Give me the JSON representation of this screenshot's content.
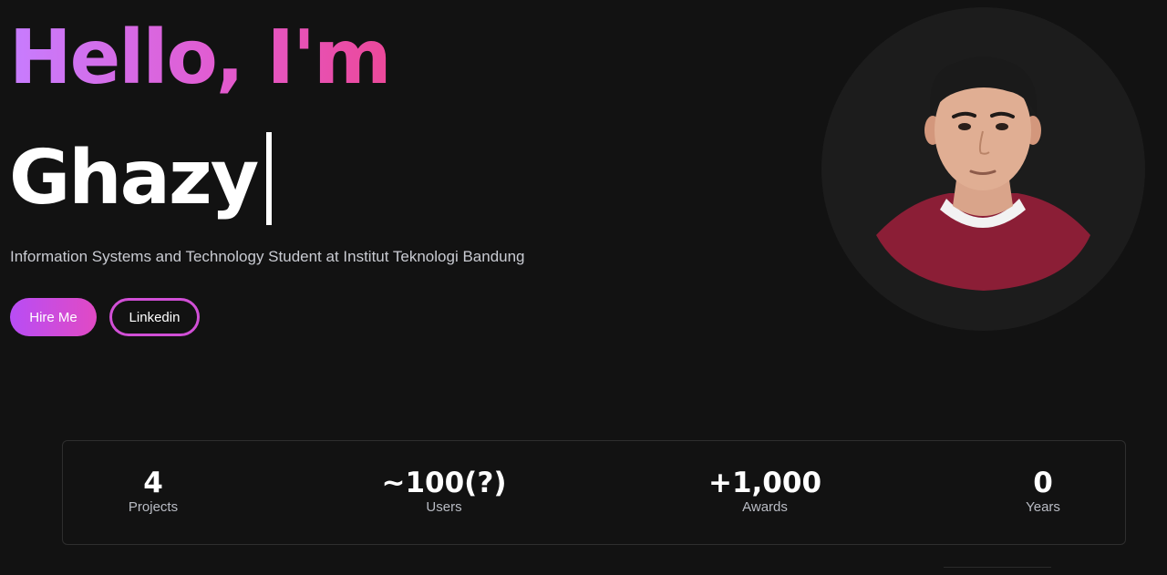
{
  "hero": {
    "greeting": "Hello, I'm",
    "name": "Ghazy",
    "subtitle": "Information Systems and Technology Student at Institut Teknologi Bandung"
  },
  "buttons": {
    "hire_me": "Hire Me",
    "linkedin": "Linkedin"
  },
  "profile_photo": {
    "icon": "profile-photo"
  },
  "stats": [
    {
      "value": "4",
      "label": "Projects"
    },
    {
      "value": "~100(?)",
      "label": "Users"
    },
    {
      "value": "+1,000",
      "label": "Awards"
    },
    {
      "value": "0",
      "label": "Years"
    }
  ],
  "colors": {
    "background": "#121212",
    "gradient_start": "#c77dff",
    "gradient_end": "#ec4899",
    "accent_border": "#d14fd6"
  }
}
